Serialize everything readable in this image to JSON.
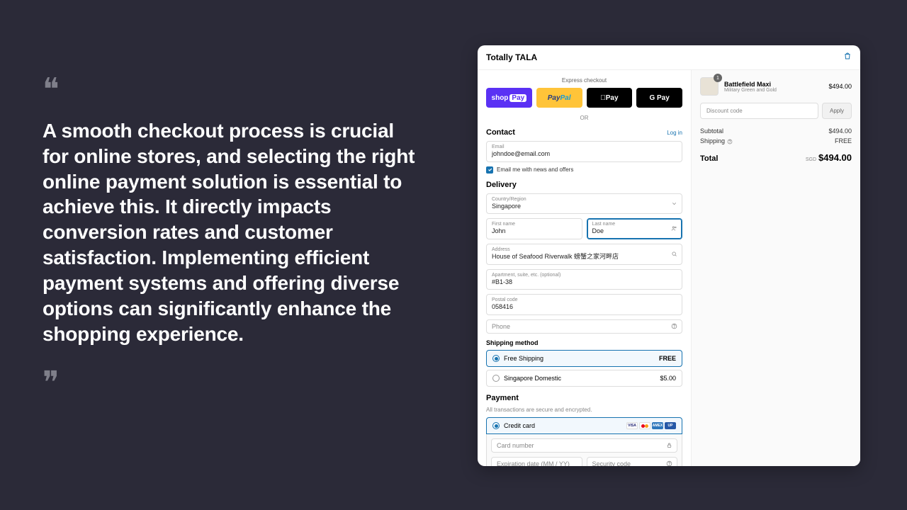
{
  "quote": {
    "text": "A smooth checkout process is crucial for online stores, and selecting the right online payment solution is essential to achieve this. It directly impacts conversion rates and customer satisfaction. Implementing efficient payment systems and offering diverse options can significantly enhance the shopping experience."
  },
  "header": {
    "brand": "Totally TALA"
  },
  "express": {
    "label": "Express checkout",
    "shop": "shop",
    "pay_suffix": "Pay",
    "paypal_pay": "Pay",
    "paypal_pal": "Pal",
    "apple": " Pay",
    "google": "G Pay",
    "or": "OR"
  },
  "contact": {
    "title": "Contact",
    "login": "Log in",
    "email_label": "Email",
    "email_value": "johndoe@email.com",
    "news": "Email me with news and offers"
  },
  "delivery": {
    "title": "Delivery",
    "country_label": "Country/Region",
    "country_value": "Singapore",
    "first_label": "First name",
    "first_value": "John",
    "last_label": "Last name",
    "last_value": "Doe",
    "address_label": "Address",
    "address_value": "House of Seafood Riverwalk 螃蟹之家河畔店",
    "apt_label": "Apartment, suite, etc. (optional)",
    "apt_value": "#B1-38",
    "postal_label": "Postal code",
    "postal_value": "058416",
    "phone_placeholder": "Phone"
  },
  "shipping": {
    "title": "Shipping method",
    "opt1_name": "Free Shipping",
    "opt1_price": "FREE",
    "opt2_name": "Singapore Domestic",
    "opt2_price": "$5.00"
  },
  "payment": {
    "title": "Payment",
    "note": "All transactions are secure and encrypted.",
    "credit": "Credit card",
    "card_number": "Card number",
    "exp": "Expiration date (MM / YY)",
    "cvv": "Security code"
  },
  "cart": {
    "item_qty": "1",
    "item_name": "Battlefield Maxi",
    "item_variant": "Military Green and Gold",
    "item_price": "$494.00",
    "discount_placeholder": "Discount code",
    "apply": "Apply",
    "subtotal_label": "Subtotal",
    "subtotal_value": "$494.00",
    "shipping_label": "Shipping",
    "shipping_value": "FREE",
    "total_label": "Total",
    "currency": "SGD",
    "total_value": "$494.00"
  }
}
